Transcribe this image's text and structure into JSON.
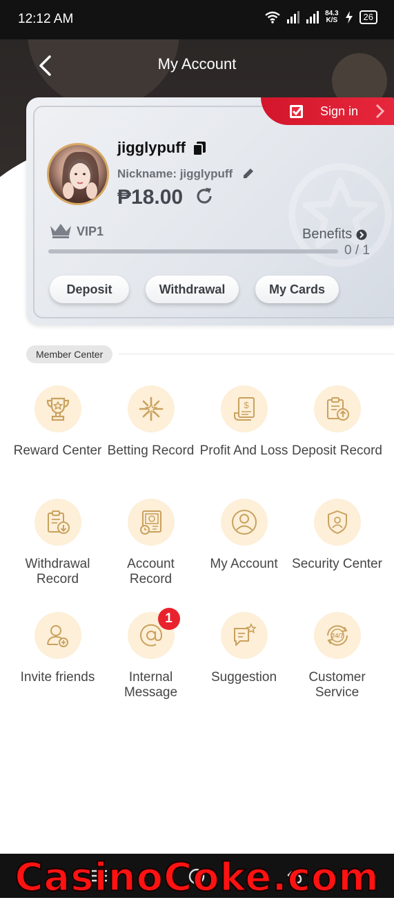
{
  "status_bar": {
    "time": "12:12 AM",
    "speed_value": "84.3",
    "speed_unit": "K/S",
    "battery": "26"
  },
  "header": {
    "title": "My Account"
  },
  "profile": {
    "signin_label": "Sign in",
    "username": "jigglypuff",
    "nickname": "Nickname: jigglypuff",
    "balance": "₱18.00",
    "vip_level": "VIP1",
    "benefits_label": "Benefits",
    "progress_text": "0 / 1",
    "progress_fraction": 0.0,
    "buttons": {
      "deposit": "Deposit",
      "withdrawal": "Withdrawal",
      "my_cards": "My Cards"
    }
  },
  "member_center": {
    "label": "Member Center",
    "items": [
      {
        "label": "Reward Center",
        "icon": "trophy-icon"
      },
      {
        "label": "Betting Record",
        "icon": "star-burst-icon"
      },
      {
        "label": "Profit And Loss",
        "icon": "receipt-icon"
      },
      {
        "label": "Deposit Record",
        "icon": "clipboard-upload-icon"
      },
      {
        "label": "Withdrawal Record",
        "icon": "clipboard-download-icon"
      },
      {
        "label": "Account Record",
        "icon": "statement-icon"
      },
      {
        "label": "My Account",
        "icon": "user-circle-icon"
      },
      {
        "label": "Security Center",
        "icon": "shield-user-icon"
      },
      {
        "label": "Invite friends",
        "icon": "user-plus-icon"
      },
      {
        "label": "Internal Message",
        "icon": "at-sign-icon",
        "badge": "1"
      },
      {
        "label": "Suggestion",
        "icon": "chat-star-icon"
      },
      {
        "label": "Customer Service",
        "icon": "support-24-7-icon"
      }
    ]
  },
  "watermark_text": "CasinoCoke.com",
  "colors": {
    "accent_red": "#e8283c",
    "icon_gold": "#c9a15e",
    "icon_bg": "#fdefd8"
  }
}
